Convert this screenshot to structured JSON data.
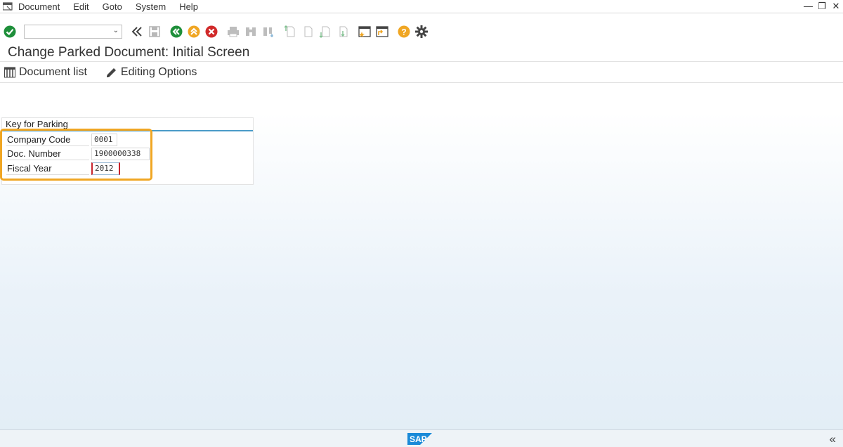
{
  "menubar": {
    "items": [
      "Document",
      "Edit",
      "Goto",
      "System",
      "Help"
    ]
  },
  "toolbar": {
    "command_value": ""
  },
  "title": "Change Parked Document: Initial Screen",
  "app_toolbar": {
    "document_list": "Document list",
    "editing_options": "Editing Options"
  },
  "group": {
    "title": "Key for Parking",
    "fields": [
      {
        "label": "Company Code",
        "value": "0001"
      },
      {
        "label": "Doc. Number",
        "value": "1900000338"
      },
      {
        "label": "Fiscal Year",
        "value": "2012"
      }
    ]
  },
  "statusbar": {
    "logo_text": "SAP",
    "collapse_glyph": "«"
  },
  "colors": {
    "highlight": "#f0a623",
    "accent_line": "#4a9bc8",
    "enter_green": "#1e8f3a",
    "cancel_red": "#d12a2a",
    "help_orange": "#f0a623"
  }
}
